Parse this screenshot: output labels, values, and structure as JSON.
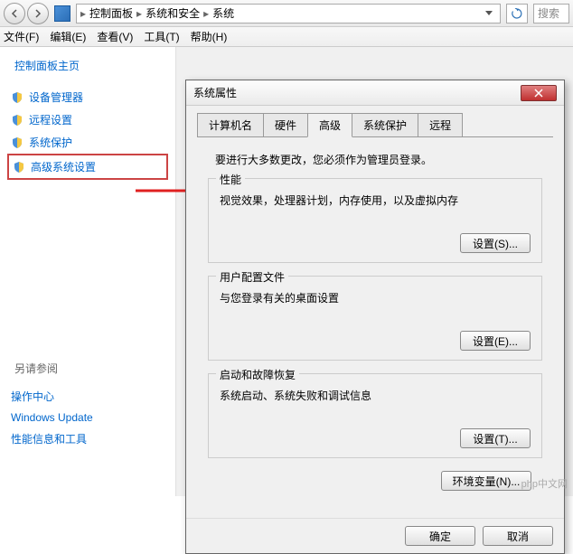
{
  "breadcrumb": {
    "items": [
      "控制面板",
      "系统和安全",
      "系统"
    ]
  },
  "search": {
    "placeholder": "搜索"
  },
  "menu": {
    "file": "文件(F)",
    "edit": "编辑(E)",
    "view": "查看(V)",
    "tools": "工具(T)",
    "help": "帮助(H)"
  },
  "sidebar": {
    "title": "控制面板主页",
    "items": [
      {
        "label": "设备管理器"
      },
      {
        "label": "远程设置"
      },
      {
        "label": "系统保护"
      },
      {
        "label": "高级系统设置"
      }
    ],
    "see_also": "另请参阅",
    "footer": [
      {
        "label": "操作中心"
      },
      {
        "label": "Windows Update"
      },
      {
        "label": "性能信息和工具"
      }
    ]
  },
  "dialog": {
    "title": "系统属性",
    "tabs": [
      "计算机名",
      "硬件",
      "高级",
      "系统保护",
      "远程"
    ],
    "admin_text": "要进行大多数更改，您必须作为管理员登录。",
    "sections": {
      "perf": {
        "title": "性能",
        "desc": "视觉效果，处理器计划，内存使用，以及虚拟内存",
        "btn": "设置(S)..."
      },
      "profile": {
        "title": "用户配置文件",
        "desc": "与您登录有关的桌面设置",
        "btn": "设置(E)..."
      },
      "startup": {
        "title": "启动和故障恢复",
        "desc": "系统启动、系统失败和调试信息",
        "btn": "设置(T)..."
      }
    },
    "env_btn": "环境变量(N)...",
    "ok": "确定",
    "cancel": "取消"
  },
  "watermark": "php中文网"
}
